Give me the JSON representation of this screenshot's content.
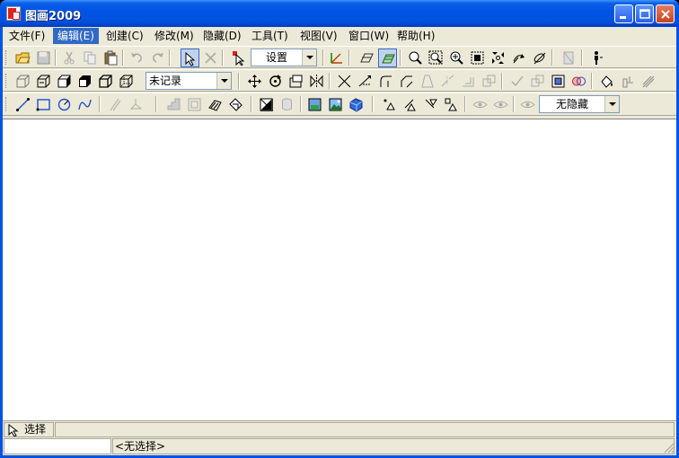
{
  "window": {
    "title": "图画2009",
    "icon": "app-icon",
    "controls": [
      "minimize-icon",
      "maximize-icon",
      "close-icon"
    ]
  },
  "menubar": {
    "items": [
      {
        "label": "文件(F)"
      },
      {
        "label": "编辑(E)",
        "active": true
      },
      {
        "label": "创建(C)"
      },
      {
        "label": "修改(M)"
      },
      {
        "label": "隐藏(D)"
      },
      {
        "label": "工具(T)"
      },
      {
        "label": "视图(V)"
      },
      {
        "label": "窗口(W)"
      },
      {
        "label": "帮助(H)"
      }
    ]
  },
  "toolbar1": {
    "settings_combo": {
      "value": "设置"
    }
  },
  "toolbar2": {
    "record_combo": {
      "value": "未记录"
    }
  },
  "toolbar3": {
    "hide_combo": {
      "value": "无隐藏"
    }
  },
  "command_bar": {
    "label": "选择",
    "icon": "select-arrow-icon"
  },
  "statusbar": {
    "selection": "<无选择>"
  },
  "colors": {
    "titlebar": "#0054e3",
    "face": "#ece9d8",
    "highlight": "#316ac5",
    "canvas": "#ffffff"
  }
}
